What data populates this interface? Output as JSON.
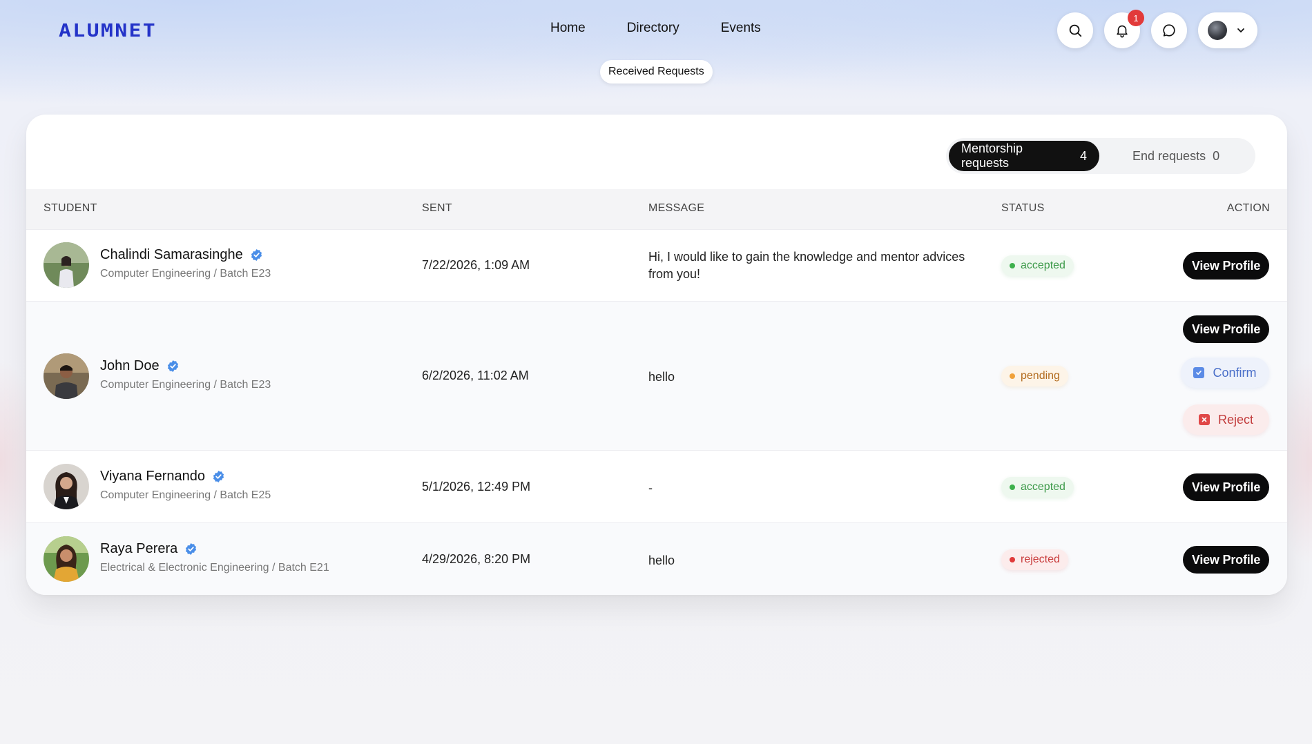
{
  "header": {
    "logo": "ALUMNET",
    "nav": [
      "Home",
      "Directory",
      "Events"
    ],
    "sub_pill": "Received Requests",
    "notification_count": "1"
  },
  "tabs": {
    "mentorship_label": "Mentorship requests",
    "mentorship_count": "4",
    "end_label": "End requests",
    "end_count": "0"
  },
  "table": {
    "headers": [
      "STUDENT",
      "SENT",
      "MESSAGE",
      "STATUS",
      "ACTION"
    ],
    "rows": [
      {
        "name": "Chalindi Samarasinghe",
        "dept": "Computer Engineering / Batch E23",
        "sent": "7/22/2026, 1:09 AM",
        "message": "Hi, I would like to gain the knowledge and mentor advices from you!",
        "status": "accepted",
        "action": "View Profile"
      },
      {
        "name": "John Doe",
        "dept": "Computer Engineering / Batch E23",
        "sent": "6/2/2026, 11:02 AM",
        "message": "hello",
        "status": "pending",
        "action": "View Profile",
        "confirm": "Confirm",
        "reject": "Reject"
      },
      {
        "name": "Viyana Fernando",
        "dept": "Computer Engineering / Batch E25",
        "sent": "5/1/2026, 12:49 PM",
        "message": "-",
        "status": "accepted",
        "action": "View Profile"
      },
      {
        "name": "Raya Perera",
        "dept": "Electrical & Electronic Engineering / Batch E21",
        "sent": "4/29/2026, 8:20 PM",
        "message": "hello",
        "status": "rejected",
        "action": "View Profile"
      }
    ]
  },
  "icons": {
    "search": "search-icon",
    "bell": "bell-icon",
    "chat": "chat-icon",
    "chevron": "chevron-down-icon",
    "verified": "verified-badge-icon"
  },
  "colors": {
    "brand": "#2433c8",
    "accepted": "#3d9a4a",
    "pending": "#b26b1e",
    "rejected": "#c93c3c",
    "confirm": "#4a6fc9"
  }
}
